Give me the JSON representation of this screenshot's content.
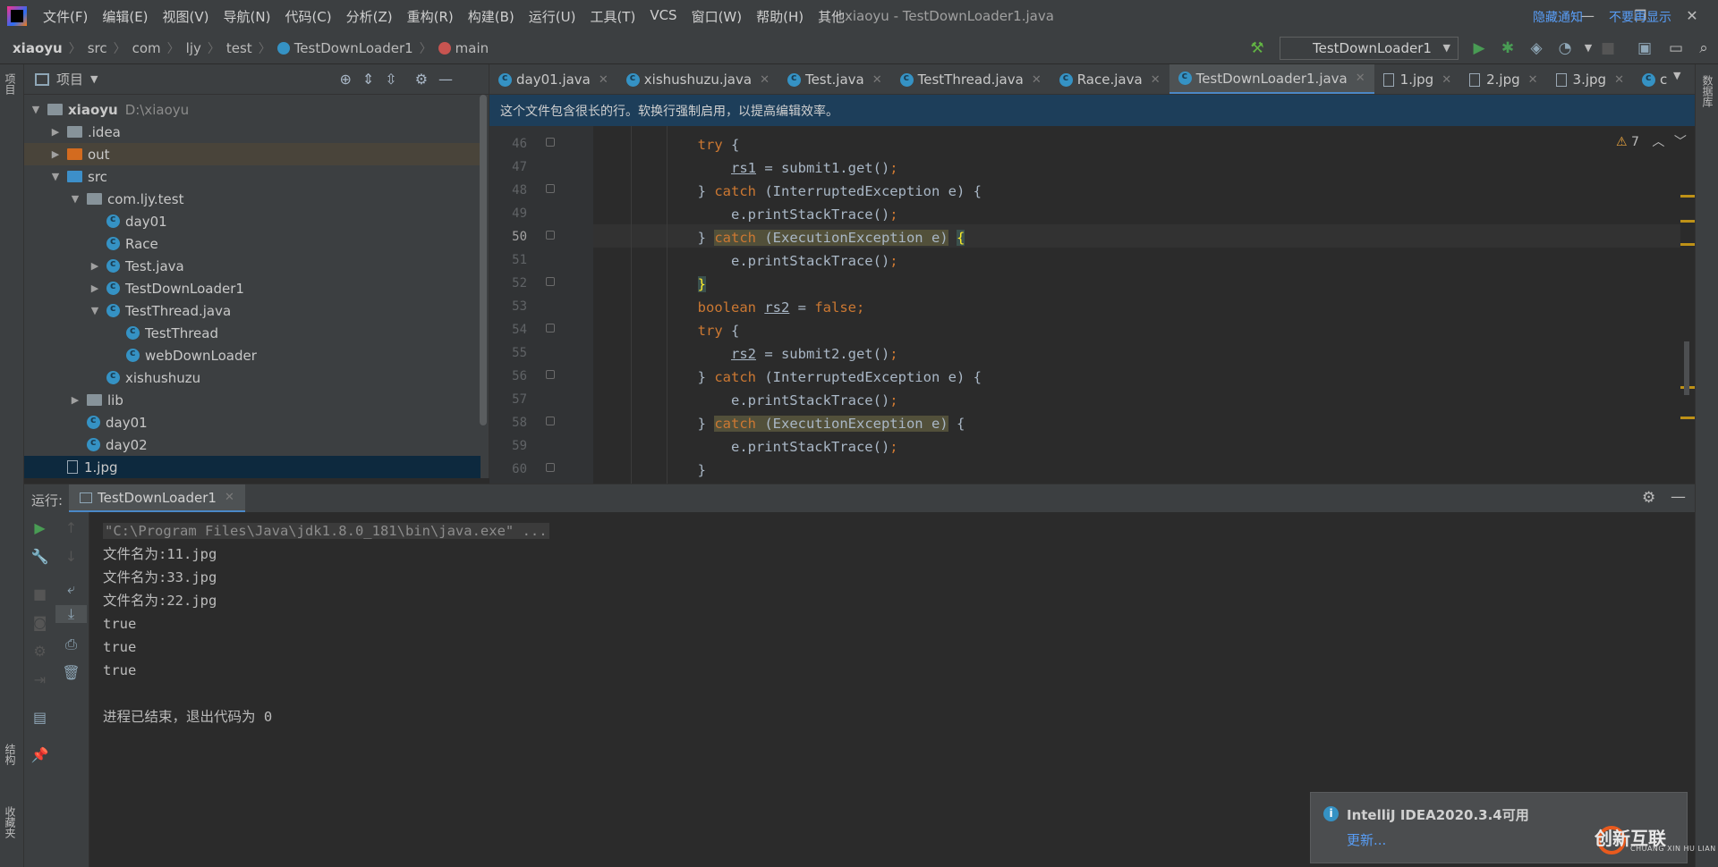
{
  "window": {
    "title": "xiaoyu - TestDownLoader1.java",
    "controls": [
      "—",
      "❐",
      "✕"
    ]
  },
  "menu": [
    "文件(F)",
    "编辑(E)",
    "视图(V)",
    "导航(N)",
    "代码(C)",
    "分析(Z)",
    "重构(R)",
    "构建(B)",
    "运行(U)",
    "工具(T)",
    "VCS",
    "窗口(W)",
    "帮助(H)",
    "其他"
  ],
  "breadcrumb": [
    "xiaoyu",
    "src",
    "com",
    "ljy",
    "test",
    "TestDownLoader1",
    "main"
  ],
  "toolbar": {
    "run_config": "TestDownLoader1"
  },
  "left_strip": {
    "project": "项目",
    "structure": "结构",
    "favorites": "收藏夹"
  },
  "right_strip": {
    "database": "数据库"
  },
  "project": {
    "title": "项目",
    "tree": [
      {
        "label": "xiaoyu",
        "extra": "D:\\xiaoyu",
        "depth": 0,
        "arrow": "▼",
        "kind": "folder-root"
      },
      {
        "label": ".idea",
        "depth": 1,
        "arrow": "▶",
        "kind": "folder"
      },
      {
        "label": "out",
        "depth": 1,
        "arrow": "▶",
        "kind": "folder-orange"
      },
      {
        "label": "src",
        "depth": 1,
        "arrow": "▼",
        "kind": "folder-blue"
      },
      {
        "label": "com.ljy.test",
        "depth": 2,
        "arrow": "▼",
        "kind": "package"
      },
      {
        "label": "day01",
        "depth": 3,
        "arrow": "",
        "kind": "class"
      },
      {
        "label": "Race",
        "depth": 3,
        "arrow": "",
        "kind": "class"
      },
      {
        "label": "Test.java",
        "depth": 3,
        "arrow": "▶",
        "kind": "class"
      },
      {
        "label": "TestDownLoader1",
        "depth": 3,
        "arrow": "▶",
        "kind": "class"
      },
      {
        "label": "TestThread.java",
        "depth": 3,
        "arrow": "▼",
        "kind": "class"
      },
      {
        "label": "TestThread",
        "depth": 4,
        "arrow": "",
        "kind": "class"
      },
      {
        "label": "webDownLoader",
        "depth": 4,
        "arrow": "",
        "kind": "class"
      },
      {
        "label": "xishushuzu",
        "depth": 3,
        "arrow": "",
        "kind": "class"
      },
      {
        "label": "lib",
        "depth": 2,
        "arrow": "▶",
        "kind": "package"
      },
      {
        "label": "day01",
        "depth": 2,
        "arrow": "",
        "kind": "class"
      },
      {
        "label": "day02",
        "depth": 2,
        "arrow": "",
        "kind": "class"
      },
      {
        "label": "1.jpg",
        "depth": 1,
        "arrow": "",
        "kind": "jpg"
      }
    ]
  },
  "editor_tabs": [
    {
      "label": "day01.java",
      "kind": "class"
    },
    {
      "label": "xishushuzu.java",
      "kind": "class"
    },
    {
      "label": "Test.java",
      "kind": "class"
    },
    {
      "label": "TestThread.java",
      "kind": "class"
    },
    {
      "label": "Race.java",
      "kind": "class"
    },
    {
      "label": "TestDownLoader1.java",
      "kind": "class",
      "active": true
    },
    {
      "label": "1.jpg",
      "kind": "jpg"
    },
    {
      "label": "2.jpg",
      "kind": "jpg"
    },
    {
      "label": "3.jpg",
      "kind": "jpg"
    },
    {
      "label": "c",
      "kind": "class"
    }
  ],
  "notice": {
    "text": "这个文件包含很长的行。软换行强制启用，以提高编辑效率。",
    "hide": "隐藏通知",
    "never": "不要再显示"
  },
  "warnings": "7",
  "code": {
    "line_numbers": [
      "46",
      "47",
      "48",
      "49",
      "50",
      "51",
      "52",
      "53",
      "54",
      "55",
      "56",
      "57",
      "58",
      "59",
      "60"
    ],
    "current_line": "50"
  },
  "run": {
    "label": "运行:",
    "tab": "TestDownLoader1",
    "console": [
      "\"C:\\Program Files\\Java\\jdk1.8.0_181\\bin\\java.exe\" ...",
      "文件名为:11.jpg",
      "文件名为:33.jpg",
      "文件名为:22.jpg",
      "true",
      "true",
      "true",
      "",
      "进程已结束，退出代码为 0"
    ]
  },
  "toast": {
    "title": "IntelliJ IDEA2020.3.4可用",
    "link": "更新..."
  },
  "watermark": {
    "text": "创新互联",
    "sub": "CHUANG XIN HU LIAN"
  },
  "colors": {
    "keyword": "#cc7832",
    "text": "#a9b7c6",
    "accent": "#4a88c7",
    "link": "#589df6"
  }
}
